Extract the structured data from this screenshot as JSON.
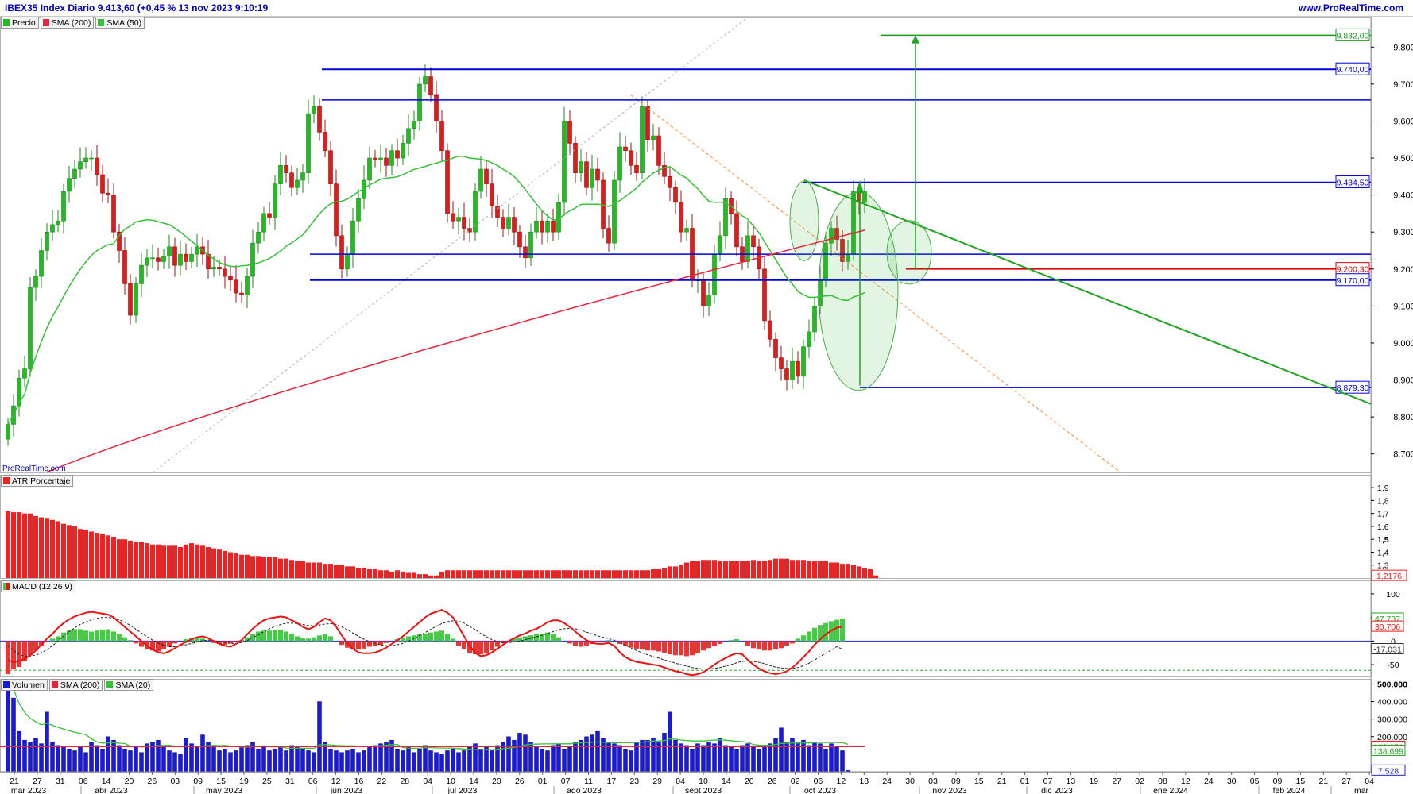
{
  "header": {
    "title": "IBEX35 Index Diario 9.413,60 (+0,45 % 13 nov 2023 9:10:19",
    "url": "www.ProRealTime.com"
  },
  "watermark": "ProRealTime.com",
  "colors": {
    "price_up": "#22bb22",
    "price_down": "#dd1c1c",
    "sma200": "#e8253c",
    "sma50": "#38c038",
    "levels_blue": "#0000dd",
    "atr": "#ee2222",
    "macd_hist": "#44cc44",
    "macd_line": "#ee1111",
    "volume": "#1a1add"
  },
  "chart_data": [
    {
      "type": "candlestick",
      "panel": "price",
      "legend": [
        "Precio",
        "SMA (200)",
        "SMA (50)"
      ],
      "y_ticks": [
        "9.800",
        "9.700",
        "9.600",
        "9.500",
        "9.400",
        "9.300",
        "9.200",
        "9.100",
        "9.000",
        "8.900",
        "8.800",
        "8.700"
      ],
      "ylim": [
        8650,
        9880
      ],
      "levels": [
        {
          "value": 9832,
          "label": "9.832,00",
          "color": "#1a9a1a"
        },
        {
          "value": 9740,
          "label": "9.740,00",
          "color": "#0000dd"
        },
        {
          "value": 9657,
          "label": "",
          "color": "#0000dd"
        },
        {
          "value": 9434.5,
          "label": "9.434,50",
          "color": "#0000dd"
        },
        {
          "value": 9240,
          "label": "",
          "color": "#0000dd"
        },
        {
          "value": 9200.3,
          "label": "9.200,30",
          "color": "#dd0000"
        },
        {
          "value": 9170,
          "label": "9.170,00",
          "color": "#0000dd"
        },
        {
          "value": 8879.3,
          "label": "8.879,30",
          "color": "#0000dd"
        }
      ],
      "closes": [
        8780,
        8830,
        8905,
        8930,
        9150,
        9180,
        9250,
        9300,
        9320,
        9330,
        9410,
        9445,
        9470,
        9490,
        9500,
        9500,
        9455,
        9405,
        9400,
        9300,
        9250,
        9160,
        9075,
        9160,
        9210,
        9230,
        9230,
        9220,
        9235,
        9260,
        9210,
        9240,
        9220,
        9240,
        9260,
        9240,
        9200,
        9205,
        9200,
        9180,
        9170,
        9135,
        9130,
        9180,
        9270,
        9300,
        9350,
        9340,
        9430,
        9480,
        9460,
        9420,
        9440,
        9460,
        9620,
        9640,
        9570,
        9520,
        9430,
        9290,
        9200,
        9240,
        9330,
        9390,
        9440,
        9500,
        9495,
        9500,
        9480,
        9520,
        9500,
        9540,
        9580,
        9600,
        9700,
        9720,
        9670,
        9600,
        9520,
        9350,
        9330,
        9340,
        9310,
        9300,
        9410,
        9470,
        9430,
        9370,
        9340,
        9310,
        9340,
        9300,
        9260,
        9230,
        9300,
        9330,
        9300,
        9330,
        9300,
        9380,
        9600,
        9540,
        9460,
        9490,
        9420,
        9470,
        9440,
        9310,
        9270,
        9440,
        9530,
        9520,
        9480,
        9460,
        9640,
        9550,
        9560,
        9480,
        9450,
        9420,
        9380,
        9300,
        9310,
        9170,
        9170,
        9100,
        9130,
        9240,
        9290,
        9390,
        9350,
        9260,
        9220,
        9290,
        9260,
        9200,
        9060,
        9010,
        8960,
        8930,
        8900,
        8950,
        8910,
        8990,
        9030,
        9100,
        9170,
        9270,
        9310,
        9280,
        9220,
        9240,
        9410,
        9380,
        9410
      ],
      "sma200_label": "SMA (200)",
      "sma50_label": "SMA (50)"
    },
    {
      "type": "bar",
      "panel": "atr",
      "legend": [
        "ATR Porcentaje"
      ],
      "y_ticks": [
        "1,9",
        "1,8",
        "1,7",
        "1,6",
        "1,5",
        "1,4",
        "1,3"
      ],
      "ylim": [
        1.2,
        1.95
      ],
      "last_value_label": "1,2176",
      "values": [
        1.72,
        1.71,
        1.71,
        1.7,
        1.7,
        1.68,
        1.67,
        1.66,
        1.65,
        1.64,
        1.62,
        1.61,
        1.6,
        1.58,
        1.57,
        1.56,
        1.55,
        1.54,
        1.53,
        1.52,
        1.5,
        1.5,
        1.49,
        1.48,
        1.48,
        1.47,
        1.46,
        1.46,
        1.45,
        1.45,
        1.45,
        1.44,
        1.46,
        1.47,
        1.46,
        1.45,
        1.44,
        1.43,
        1.42,
        1.41,
        1.4,
        1.39,
        1.38,
        1.38,
        1.37,
        1.37,
        1.36,
        1.36,
        1.36,
        1.35,
        1.35,
        1.34,
        1.33,
        1.33,
        1.32,
        1.32,
        1.32,
        1.31,
        1.31,
        1.3,
        1.3,
        1.29,
        1.29,
        1.28,
        1.28,
        1.27,
        1.27,
        1.26,
        1.26,
        1.25,
        1.26,
        1.25,
        1.24,
        1.24,
        1.23,
        1.23,
        1.22,
        1.22,
        1.25,
        1.26,
        1.26,
        1.26,
        1.26,
        1.26,
        1.26,
        1.26,
        1.26,
        1.26,
        1.26,
        1.26,
        1.26,
        1.26,
        1.26,
        1.26,
        1.26,
        1.26,
        1.26,
        1.26,
        1.26,
        1.26,
        1.26,
        1.26,
        1.26,
        1.26,
        1.26,
        1.26,
        1.26,
        1.26,
        1.26,
        1.26,
        1.26,
        1.26,
        1.26,
        1.26,
        1.26,
        1.26,
        1.27,
        1.27,
        1.28,
        1.29,
        1.29,
        1.3,
        1.32,
        1.33,
        1.33,
        1.34,
        1.34,
        1.34,
        1.33,
        1.33,
        1.33,
        1.33,
        1.33,
        1.33,
        1.34,
        1.33,
        1.33,
        1.34,
        1.35,
        1.35,
        1.35,
        1.34,
        1.34,
        1.34,
        1.33,
        1.33,
        1.33,
        1.33,
        1.32,
        1.32,
        1.31,
        1.31,
        1.3,
        1.29,
        1.28,
        1.27,
        1.22
      ]
    },
    {
      "type": "bar+line",
      "panel": "macd",
      "legend": [
        "MACD (12 26 9)"
      ],
      "y_ticks": [
        "100",
        "50",
        "0",
        "-50"
      ],
      "ylim": [
        -75,
        125
      ],
      "value_labels": [
        "47,737",
        "30,706",
        "-17,031"
      ],
      "histogram": [
        -70,
        -60,
        -55,
        -42,
        -30,
        -20,
        -10,
        0,
        5,
        10,
        18,
        22,
        25,
        25,
        22,
        20,
        22,
        24,
        25,
        20,
        15,
        8,
        2,
        -5,
        -12,
        -18,
        -20,
        -22,
        -18,
        -12,
        -5,
        0,
        4,
        6,
        8,
        5,
        0,
        -4,
        -6,
        -8,
        -5,
        -2,
        2,
        8,
        15,
        20,
        22,
        22,
        24,
        24,
        20,
        15,
        10,
        6,
        5,
        8,
        12,
        14,
        10,
        0,
        -8,
        -14,
        -18,
        -18,
        -16,
        -12,
        -10,
        -8,
        -4,
        0,
        4,
        6,
        10,
        12,
        14,
        16,
        18,
        20,
        22,
        15,
        5,
        -10,
        -18,
        -25,
        -28,
        -28,
        -26,
        -20,
        -12,
        -5,
        0,
        5,
        8,
        10,
        12,
        14,
        16,
        18,
        15,
        8,
        0,
        -5,
        -10,
        -12,
        -10,
        -6,
        -2,
        0,
        2,
        0,
        -6,
        -10,
        -14,
        -16,
        -18,
        -20,
        -20,
        -22,
        -25,
        -28,
        -30,
        -30,
        -32,
        -30,
        -26,
        -20,
        -15,
        -10,
        -6,
        0,
        2,
        4,
        0,
        -10,
        -15,
        -18,
        -20,
        -20,
        -18,
        -15,
        -10,
        -5,
        5,
        12,
        20,
        28,
        34,
        38,
        42,
        45,
        47.7
      ],
      "macd_line": [
        -40,
        -45,
        -42,
        -38,
        -30,
        -20,
        -8,
        5,
        15,
        28,
        38,
        46,
        52,
        56,
        60,
        62,
        60,
        58,
        56,
        50,
        40,
        30,
        20,
        10,
        0,
        -10,
        -18,
        -24,
        -26,
        -22,
        -15,
        -8,
        -2,
        4,
        8,
        10,
        6,
        0,
        -6,
        -10,
        -12,
        -6,
        2,
        14,
        26,
        36,
        44,
        48,
        50,
        52,
        50,
        44,
        38,
        30,
        25,
        30,
        40,
        48,
        44,
        30,
        12,
        -4,
        -16,
        -24,
        -26,
        -26,
        -24,
        -20,
        -14,
        -6,
        2,
        10,
        20,
        30,
        40,
        50,
        58,
        62,
        66,
        60,
        50,
        30,
        10,
        -10,
        -25,
        -32,
        -30,
        -24,
        -16,
        -8,
        0,
        6,
        12,
        16,
        22,
        26,
        32,
        40,
        44,
        44,
        38,
        30,
        20,
        10,
        2,
        -4,
        -6,
        -6,
        -4,
        -10,
        -24,
        -34,
        -40,
        -44,
        -46,
        -48,
        -50,
        -52,
        -56,
        -60,
        -64,
        -66,
        -70,
        -72,
        -70,
        -66,
        -58,
        -50,
        -42,
        -36,
        -30,
        -26,
        -28,
        -40,
        -50,
        -58,
        -64,
        -68,
        -70,
        -68,
        -64,
        -56,
        -46,
        -34,
        -22,
        -8,
        4,
        14,
        22,
        28,
        30.7
      ],
      "signal_line": [
        -10,
        -20,
        -28,
        -32,
        -32,
        -30,
        -25,
        -18,
        -10,
        0,
        10,
        20,
        28,
        35,
        40,
        45,
        48,
        50,
        50,
        48,
        45,
        40,
        33,
        25,
        17,
        9,
        2,
        -4,
        -9,
        -12,
        -12,
        -10,
        -8,
        -5,
        -2,
        1,
        2,
        1,
        -1,
        -3,
        -5,
        -5,
        -3,
        1,
        7,
        13,
        20,
        26,
        31,
        35,
        38,
        38,
        37,
        35,
        33,
        32,
        34,
        36,
        37,
        35,
        30,
        24,
        17,
        10,
        4,
        -1,
        -5,
        -8,
        -10,
        -10,
        -8,
        -5,
        0,
        5,
        12,
        18,
        25,
        31,
        37,
        41,
        43,
        42,
        38,
        31,
        24,
        16,
        9,
        3,
        -1,
        -3,
        -3,
        -2,
        0,
        3,
        6,
        9,
        12,
        16,
        20,
        24,
        26,
        27,
        26,
        23,
        19,
        15,
        11,
        8,
        5,
        2,
        -3,
        -9,
        -15,
        -20,
        -25,
        -29,
        -33,
        -36,
        -40,
        -43,
        -47,
        -50,
        -53,
        -56,
        -58,
        -59,
        -59,
        -58,
        -56,
        -53,
        -50,
        -46,
        -43,
        -42,
        -43,
        -45,
        -48,
        -52,
        -55,
        -57,
        -58,
        -58,
        -56,
        -52,
        -47,
        -40,
        -33,
        -26,
        -19,
        -12,
        -17
      ]
    },
    {
      "type": "bar",
      "panel": "volume",
      "legend": [
        "Volumen",
        "SMA (200)",
        "SMA (20)"
      ],
      "y_ticks": [
        "500.000",
        "400.000",
        "300.000",
        "200.000"
      ],
      "ylim": [
        0,
        520000
      ],
      "value_labels": [
        "142.851",
        "138.699",
        "7.528"
      ],
      "values": [
        520000,
        420000,
        230000,
        180000,
        170000,
        190000,
        160000,
        340000,
        170000,
        150000,
        140000,
        130000,
        120000,
        140000,
        110000,
        170000,
        150000,
        130000,
        200000,
        180000,
        150000,
        130000,
        120000,
        140000,
        110000,
        160000,
        170000,
        180000,
        150000,
        120000,
        110000,
        100000,
        190000,
        160000,
        140000,
        210000,
        170000,
        140000,
        120000,
        130000,
        110000,
        120000,
        140000,
        150000,
        170000,
        130000,
        140000,
        120000,
        130000,
        140000,
        120000,
        150000,
        140000,
        130000,
        120000,
        110000,
        400000,
        170000,
        130000,
        120000,
        110000,
        120000,
        130000,
        110000,
        120000,
        140000,
        150000,
        160000,
        170000,
        180000,
        130000,
        120000,
        140000,
        110000,
        130000,
        150000,
        120000,
        110000,
        100000,
        120000,
        130000,
        110000,
        120000,
        140000,
        160000,
        130000,
        140000,
        120000,
        150000,
        170000,
        200000,
        180000,
        220000,
        210000,
        170000,
        140000,
        130000,
        120000,
        150000,
        160000,
        130000,
        140000,
        170000,
        180000,
        200000,
        210000,
        230000,
        190000,
        170000,
        160000,
        150000,
        130000,
        120000,
        170000,
        180000,
        180000,
        190000,
        170000,
        220000,
        340000,
        180000,
        160000,
        150000,
        130000,
        160000,
        150000,
        170000,
        160000,
        190000,
        150000,
        140000,
        130000,
        150000,
        160000,
        140000,
        130000,
        150000,
        160000,
        190000,
        250000,
        170000,
        190000,
        170000,
        180000,
        150000,
        170000,
        160000,
        130000,
        160000,
        140000,
        120000,
        7528
      ]
    }
  ],
  "x_axis": {
    "days": [
      "21",
      "27",
      "31",
      "06",
      "14",
      "20",
      "26",
      "03",
      "09",
      "15",
      "19",
      "25",
      "31",
      "06",
      "12",
      "16",
      "22",
      "28",
      "04",
      "10",
      "14",
      "20",
      "26",
      "01",
      "07",
      "11",
      "17",
      "23",
      "29",
      "04",
      "10",
      "14",
      "20",
      "26",
      "02",
      "06",
      "12",
      "18",
      "24",
      "30",
      "03",
      "09",
      "15",
      "21",
      "01",
      "07",
      "13",
      "19",
      "27",
      "02",
      "08",
      "12",
      "24",
      "30",
      "05",
      "09",
      "15",
      "21",
      "27",
      "04"
    ],
    "months": [
      "mar 2023",
      "abr 2023",
      "may 2023",
      "jun 2023",
      "jul 2023",
      "ago 2023",
      "sept 2023",
      "oct 2023",
      "nov 2023",
      "dic 2023",
      "ene 2024",
      "feb 2024",
      "mar"
    ]
  }
}
